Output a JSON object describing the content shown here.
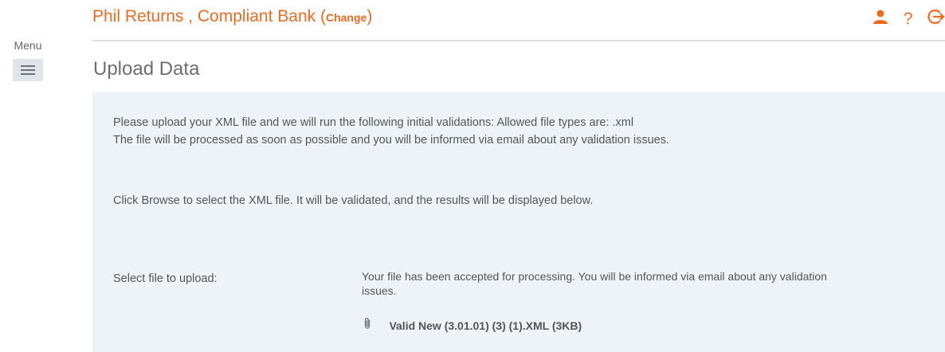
{
  "menu": {
    "label": "Menu",
    "icon": "hamburger-icon"
  },
  "header": {
    "user_bank": "Phil Returns , Compliant Bank",
    "change_label": "Change",
    "accent_color": "#ee6a1f",
    "icons": [
      "user-icon",
      "help-icon",
      "logout-icon"
    ],
    "help_glyph": "?"
  },
  "page": {
    "title": "Upload Data"
  },
  "upload": {
    "instruction_1": "Please upload your XML file and we will run the following initial validations: Allowed file types are: .xml",
    "instruction_2": "The file will be processed as soon as possible and you will be informed via email about any validation issues.",
    "instruction_3": "Click Browse to select the XML file. It will be validated, and the results will be displayed below.",
    "select_label": "Select file to upload:",
    "accepted_message": "Your file has been accepted for processing. You will be informed via email about any validation issues.",
    "file_name": "Valid New (3.01.01) (3) (1).XML (3KB)",
    "file_icon": "paperclip-icon"
  }
}
